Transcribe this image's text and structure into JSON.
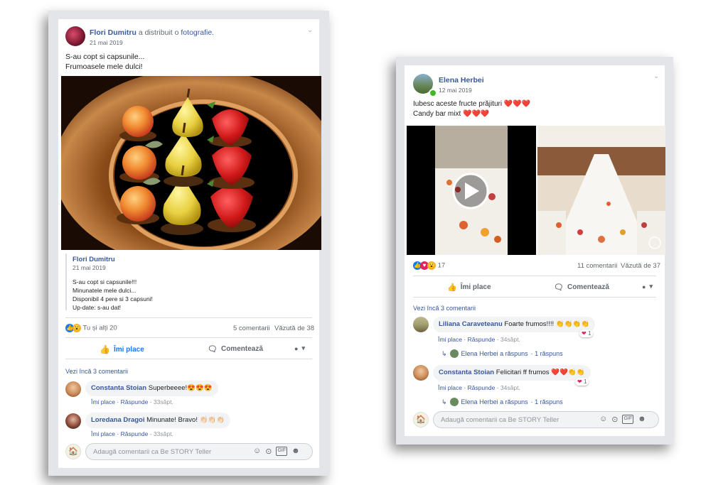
{
  "left_post": {
    "author": "Flori Dumitru",
    "action_text": "a distribuit o",
    "action_link": "fotografie.",
    "date": "21 mai 2019",
    "text_lines": [
      "S-au copt si capsunile...",
      "Frumoasele mele dulci!"
    ],
    "shared": {
      "author": "Flori Dumitru",
      "date": "21 mai 2019",
      "lines": [
        "S-au copt si capsunile!!!",
        "Minunatele mele dulci...",
        "Disponibil 4 pere si 3 capsuni!",
        "Up-date: s-au dat!"
      ]
    },
    "reactions_text": "Tu și alți 20",
    "comments_count": "5 comentarii",
    "views": "Văzută de 38",
    "like_label": "Îmi place",
    "comment_label": "Comentează",
    "more_comments": "Vezi încă 3 comentarii",
    "comments": [
      {
        "author": "Constanta Stoian",
        "text": "Superbeeee!😍😍😍",
        "like": "Îmi place",
        "reply": "Răspunde",
        "time": "33săpt."
      },
      {
        "author": "Loredana Dragoi",
        "text": "Minunate! Bravo! 👏🏻👏🏻👏🏻",
        "like": "Îmi place",
        "reply": "Răspunde",
        "time": "33săpt."
      }
    ],
    "input_placeholder": "Adaugă comentarii ca Be STORY Teller"
  },
  "right_post": {
    "author": "Elena Herbei",
    "date": "12 mai 2019",
    "text_lines": [
      "Iubesc aceste fructe prăjituri ❤️❤️❤️",
      "Candy bar mixt ❤️❤️❤️"
    ],
    "reactions_count": "17",
    "comments_count": "11 comentarii",
    "views": "Văzută de 37",
    "like_label": "Îmi place",
    "comment_label": "Comentează",
    "more_comments": "Vezi încă 3 comentarii",
    "comments": [
      {
        "author": "Liliana Caraveteanu",
        "text": "Foarte frumos!!!! 👏👏👏👏",
        "like": "Îmi place",
        "reply": "Răspunde",
        "time": "34săpt.",
        "heart_count": "1",
        "reply_text": "Elena Herbei a răspuns",
        "reply_count": "· 1 răspuns"
      },
      {
        "author": "Constanta Stoian",
        "text": "Felicitari ff frumos ❤️❤️👏👏",
        "like": "Îmi place",
        "reply": "Răspunde",
        "time": "34săpt.",
        "heart_count": "1",
        "reply_text": "Elena Herbei a răspuns",
        "reply_count": "· 1 răspuns"
      }
    ],
    "input_placeholder": "Adaugă comentarii ca Be STORY Teller"
  },
  "colors": {
    "link": "#385898",
    "like_blue": "#1877f2",
    "card_bg": "#e4e5e9",
    "heart": "#e0245e"
  }
}
